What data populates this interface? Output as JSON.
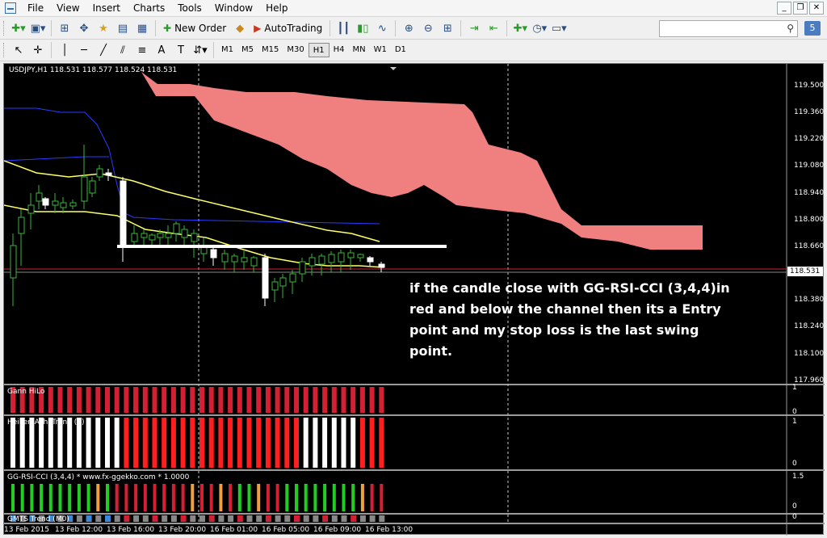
{
  "menu": [
    "File",
    "View",
    "Insert",
    "Charts",
    "Tools",
    "Window",
    "Help"
  ],
  "toolbar": {
    "new_order": "New Order",
    "autotrading": "AutoTrading",
    "notifications": "5"
  },
  "timeframes": [
    "M1",
    "M5",
    "M15",
    "M30",
    "H1",
    "H4",
    "MN",
    "W1",
    "D1"
  ],
  "active_timeframe": "H1",
  "chart": {
    "symbol_label": "USDJPY,H1  118.531 118.577 118.524 118.531",
    "current_price": "118.531",
    "price_ticks": [
      "119.500",
      "119.360",
      "119.220",
      "119.080",
      "118.940",
      "118.800",
      "118.660",
      "118.380",
      "118.240",
      "118.100",
      "117.960"
    ],
    "time_labels": [
      "13 Feb 2015",
      "13 Feb 12:00",
      "13 Feb 16:00",
      "13 Feb 20:00",
      "16 Feb 01:00",
      "16 Feb 05:00",
      "16 Feb 09:00",
      "16 Feb 13:00"
    ],
    "annotation": "if the candle close with GG-RSI-CCI (3,4,4)in red and below the channel then its a Entry point and my stop loss is the last swing point."
  },
  "indicators": [
    {
      "label": "Gann HiLo",
      "scale_top": "1",
      "scale_bottom": "0"
    },
    {
      "label": "Heiken Ashi-Trend (1)",
      "scale_top": "1",
      "scale_bottom": "0"
    },
    {
      "label": "GG-RSI-CCI (3,4,4) * www.fx-ggekko.com * 1.0000",
      "scale_top": "1.5",
      "scale_bottom": "0"
    },
    {
      "label": "GMTS Trend (M0)",
      "scale_top": "0",
      "scale_bottom": ""
    }
  ],
  "colors": {
    "cloud": "#f08080",
    "candle_white": "#ffffff",
    "candle_up": "#3cb43c",
    "ma": "#ffff66",
    "kijun": "#2a3cff",
    "red_bar": "#d42035",
    "green_bar": "#22cc22",
    "orange_bar": "#f0a040"
  }
}
